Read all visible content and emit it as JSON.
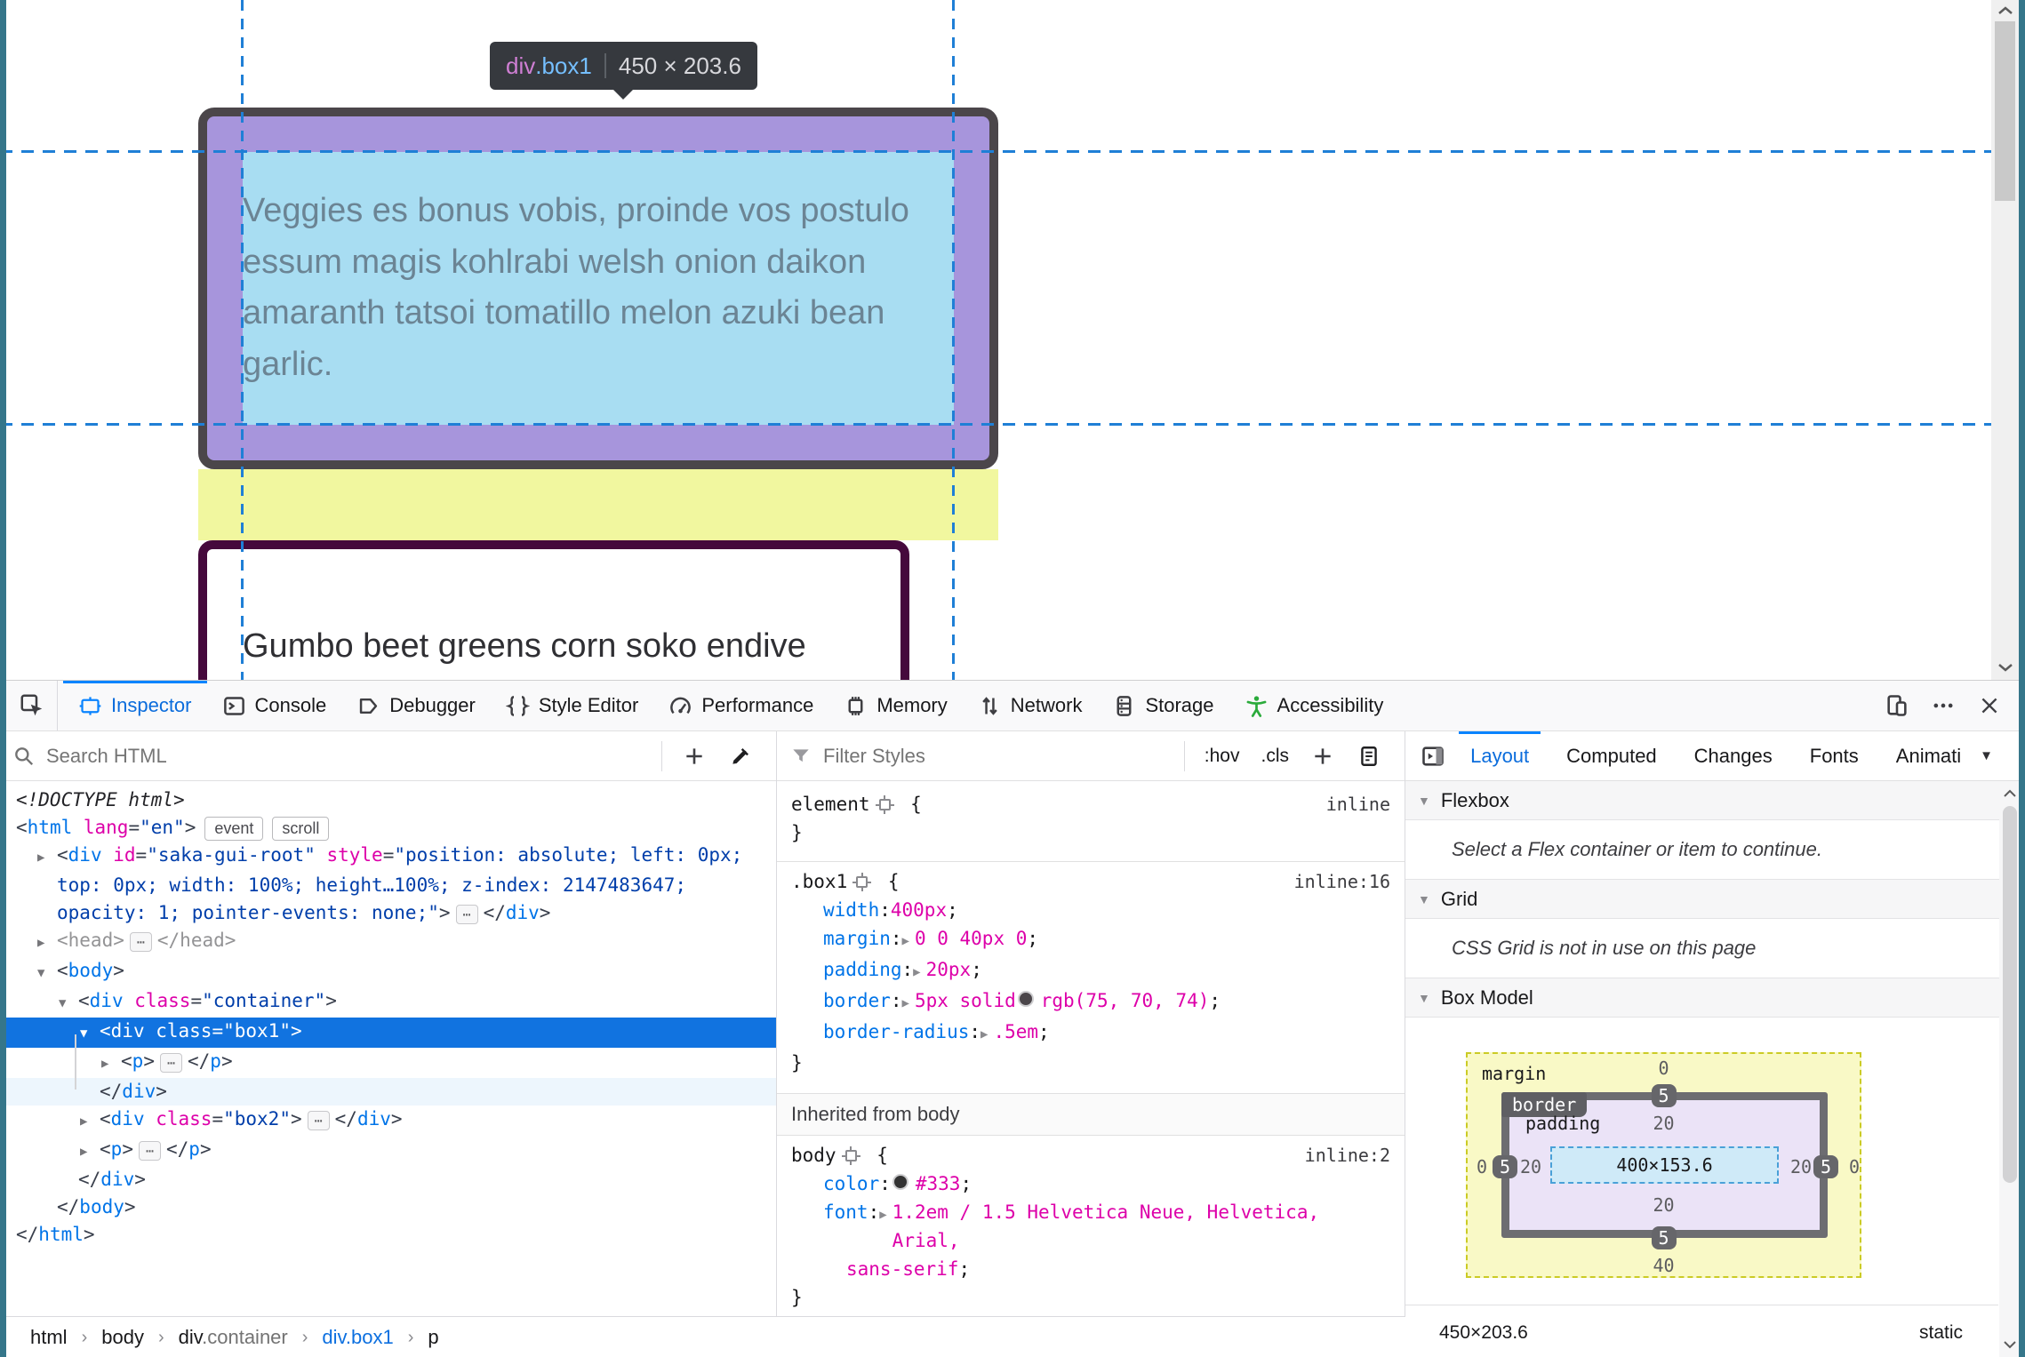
{
  "page": {
    "tooltip": {
      "tag": "div",
      "cls": ".box1",
      "size": "450 × 203.6"
    },
    "box1_text": "Veggies es bonus vobis, proinde vos postulo\nessum magis kohlrabi welsh onion daikon\namaranth tatsoi tomatillo melon azuki bean\ngarlic.",
    "box2_text": "Gumbo beet greens corn soko endive",
    "highlight_colors": {
      "content": "#a8ddf2",
      "padding": "#a795dc",
      "margin": "#f1f79f",
      "border": "#4b464a",
      "guide": "#1f7fd6"
    }
  },
  "devtools": {
    "accent": "#0a84ff",
    "main_tabs": [
      "Inspector",
      "Console",
      "Debugger",
      "Style Editor",
      "Performance",
      "Memory",
      "Network",
      "Storage",
      "Accessibility"
    ],
    "search_placeholder": "Search HTML",
    "filter_placeholder": "Filter Styles",
    "pseudo_toggle": ":hov",
    "class_toggle": ".cls",
    "markup": {
      "rows": [
        [
          {
            "c": "doct",
            "t": "<!DOCTYPE html>"
          }
        ],
        [
          {
            "c": "brk",
            "t": "<"
          },
          {
            "c": "tag",
            "t": "html"
          },
          {
            "c": "attr",
            "t": " lang"
          },
          {
            "c": "brk",
            "t": "="
          },
          {
            "c": "val",
            "t": "\"en\""
          },
          {
            "c": "brk",
            "t": ">"
          },
          {
            "c": "badge",
            "t": "event"
          },
          {
            "c": "badge",
            "t": "scroll"
          }
        ],
        [
          {
            "c": "exp",
            "t": "▶"
          },
          {
            "c": "brk",
            "t": "<"
          },
          {
            "c": "tag",
            "t": "div"
          },
          {
            "c": "attr",
            "t": " id"
          },
          {
            "c": "brk",
            "t": "="
          },
          {
            "c": "val",
            "t": "\"saka-gui-root\""
          },
          {
            "c": "attr",
            "t": " style"
          },
          {
            "c": "brk",
            "t": "="
          },
          {
            "c": "val",
            "t": "\"position: absolute; left: 0px; top: 0px; width: 100%; height…100%; z-index: 2147483647; opacity: 1; pointer-events: none;\""
          },
          {
            "c": "brk",
            "t": ">"
          },
          {
            "c": "chip",
            "t": "⋯"
          },
          {
            "c": "brk",
            "t": "</"
          },
          {
            "c": "tag",
            "t": "div"
          },
          {
            "c": "brk",
            "t": ">"
          }
        ],
        [
          {
            "c": "exp",
            "t": "▶"
          },
          {
            "c": "gray",
            "t": "<head>"
          },
          {
            "c": "chip",
            "t": "⋯"
          },
          {
            "c": "gray",
            "t": "</head>"
          }
        ],
        [
          {
            "c": "exp",
            "t": "▼"
          },
          {
            "c": "brk",
            "t": "<"
          },
          {
            "c": "tag",
            "t": "body"
          },
          {
            "c": "brk",
            "t": ">"
          }
        ],
        [
          {
            "c": "exp",
            "t": "▼"
          },
          {
            "c": "brk",
            "t": "<"
          },
          {
            "c": "tag",
            "t": "div"
          },
          {
            "c": "attr",
            "t": " class"
          },
          {
            "c": "brk",
            "t": "="
          },
          {
            "c": "val",
            "t": "\"container\""
          },
          {
            "c": "brk",
            "t": ">"
          }
        ],
        [
          {
            "c": "exp",
            "t": "▼"
          },
          {
            "c": "brk",
            "t": "<"
          },
          {
            "c": "tag",
            "t": "div"
          },
          {
            "c": "attr",
            "t": " class"
          },
          {
            "c": "brk",
            "t": "="
          },
          {
            "c": "val",
            "t": "\"box1\""
          },
          {
            "c": "brk",
            "t": ">"
          }
        ],
        [
          {
            "c": "exp",
            "t": "▶"
          },
          {
            "c": "brk",
            "t": "<"
          },
          {
            "c": "tag",
            "t": "p"
          },
          {
            "c": "brk",
            "t": ">"
          },
          {
            "c": "chip",
            "t": "⋯"
          },
          {
            "c": "brk",
            "t": "</"
          },
          {
            "c": "tag",
            "t": "p"
          },
          {
            "c": "brk",
            "t": ">"
          }
        ],
        [
          {
            "c": "brk",
            "t": "</"
          },
          {
            "c": "tag",
            "t": "div"
          },
          {
            "c": "brk",
            "t": ">"
          }
        ],
        [
          {
            "c": "exp",
            "t": "▶"
          },
          {
            "c": "brk",
            "t": "<"
          },
          {
            "c": "tag",
            "t": "div"
          },
          {
            "c": "attr",
            "t": " class"
          },
          {
            "c": "brk",
            "t": "="
          },
          {
            "c": "val",
            "t": "\"box2\""
          },
          {
            "c": "brk",
            "t": ">"
          },
          {
            "c": "chip",
            "t": "⋯"
          },
          {
            "c": "brk",
            "t": "</"
          },
          {
            "c": "tag",
            "t": "div"
          },
          {
            "c": "brk",
            "t": ">"
          }
        ],
        [
          {
            "c": "exp",
            "t": "▶"
          },
          {
            "c": "brk",
            "t": "<"
          },
          {
            "c": "tag",
            "t": "p"
          },
          {
            "c": "brk",
            "t": ">"
          },
          {
            "c": "chip",
            "t": "⋯"
          },
          {
            "c": "brk",
            "t": "</"
          },
          {
            "c": "tag",
            "t": "p"
          },
          {
            "c": "brk",
            "t": ">"
          }
        ],
        [
          {
            "c": "brk",
            "t": "</"
          },
          {
            "c": "tag",
            "t": "div"
          },
          {
            "c": "brk",
            "t": ">"
          }
        ],
        [
          {
            "c": "brk",
            "t": "</"
          },
          {
            "c": "tag",
            "t": "body"
          },
          {
            "c": "brk",
            "t": ">"
          }
        ],
        [
          {
            "c": "brk",
            "t": "</"
          },
          {
            "c": "tag",
            "t": "html"
          },
          {
            "c": "brk",
            "t": ">"
          }
        ]
      ]
    },
    "rules": {
      "r1_selector": [
        {
          "c": "rsel",
          "t": "element"
        },
        {
          "c": "target",
          "t": ""
        },
        {
          "c": "rbrk",
          "t": " {"
        }
      ],
      "r1_note": "inline",
      "r1_close": "}",
      "r2_selector": [
        {
          "c": "rsel",
          "t": ".box1"
        },
        {
          "c": "target",
          "t": ""
        },
        {
          "c": "rbrk",
          "t": " {"
        }
      ],
      "r2_note": "inline:16",
      "r2_lines": [
        [
          {
            "c": "rprop",
            "t": "width"
          },
          {
            "c": "rbrk",
            "t": ": "
          },
          {
            "c": "rval",
            "t": "400px"
          },
          {
            "c": "rbrk",
            "t": ";"
          }
        ],
        [
          {
            "c": "rprop",
            "t": "margin"
          },
          {
            "c": "rbrk",
            "t": ": "
          },
          {
            "c": "rexp",
            "t": "▶"
          },
          {
            "c": "rval",
            "t": "0 0 40px 0"
          },
          {
            "c": "rbrk",
            "t": ";"
          }
        ],
        [
          {
            "c": "rprop",
            "t": "padding"
          },
          {
            "c": "rbrk",
            "t": ": "
          },
          {
            "c": "rexp",
            "t": "▶"
          },
          {
            "c": "rval",
            "t": "20px"
          },
          {
            "c": "rbrk",
            "t": ";"
          }
        ],
        [
          {
            "c": "rprop",
            "t": "border"
          },
          {
            "c": "rbrk",
            "t": ": "
          },
          {
            "c": "rexp",
            "t": "▶"
          },
          {
            "c": "rval",
            "t": "5px solid"
          },
          {
            "c": "sw",
            "t": "",
            "v": "#4b464a"
          },
          {
            "c": "rval",
            "t": "rgb(75, 70, 74)"
          },
          {
            "c": "rbrk",
            "t": ";"
          }
        ],
        [
          {
            "c": "rprop",
            "t": "border-radius"
          },
          {
            "c": "rbrk",
            "t": ": "
          },
          {
            "c": "rexp",
            "t": "▶"
          },
          {
            "c": "rval",
            "t": ".5em"
          },
          {
            "c": "rbrk",
            "t": ";"
          }
        ]
      ],
      "r2_close": "}",
      "inherited_header": "Inherited from body",
      "r3_selector": [
        {
          "c": "rsel",
          "t": "body"
        },
        {
          "c": "target",
          "t": ""
        },
        {
          "c": "rbrk",
          "t": " {"
        }
      ],
      "r3_note": "inline:2",
      "r3_lines": [
        [
          {
            "c": "rprop",
            "t": "color"
          },
          {
            "c": "rbrk",
            "t": ": "
          },
          {
            "c": "sw",
            "t": "",
            "v": "#333"
          },
          {
            "c": "rval",
            "t": "#333"
          },
          {
            "c": "rbrk",
            "t": ";"
          }
        ],
        [
          {
            "c": "rprop",
            "t": "font"
          },
          {
            "c": "rbrk",
            "t": ": "
          },
          {
            "c": "rexp",
            "t": "▶"
          },
          {
            "c": "rval",
            "t": "1.2em / 1.5 Helvetica Neue, Helvetica, Arial,"
          }
        ],
        [
          {
            "c": "rval",
            "t": "sans-serif"
          },
          {
            "c": "rbrk",
            "t": ";"
          }
        ]
      ],
      "r3_close": "}"
    },
    "sidebar": {
      "tabs": [
        "Layout",
        "Computed",
        "Changes",
        "Fonts",
        "Animati"
      ],
      "flexbox": {
        "title": "Flexbox",
        "message": "Select a Flex container or item to continue."
      },
      "grid": {
        "title": "Grid",
        "message": "CSS Grid is not in use on this page"
      },
      "boxmodel": {
        "title": "Box Model",
        "margin_label": "margin",
        "border_label": "border",
        "padding_label": "padding",
        "margin": {
          "top": "0",
          "right": "0",
          "bottom": "40",
          "left": "0"
        },
        "border": {
          "top": "5",
          "right": "5",
          "bottom": "5",
          "left": "5"
        },
        "padding": {
          "top": "20",
          "right": "20",
          "bottom": "20",
          "left": "20"
        },
        "content": "400×153.6",
        "footer_size": "450×203.6",
        "footer_position": "static"
      }
    },
    "breadcrumb": {
      "items": [
        {
          "label": "html"
        },
        {
          "label": "body"
        },
        {
          "label": "div",
          "muted": ".container"
        },
        {
          "label": "div.box1"
        },
        {
          "label": "p"
        }
      ]
    }
  }
}
